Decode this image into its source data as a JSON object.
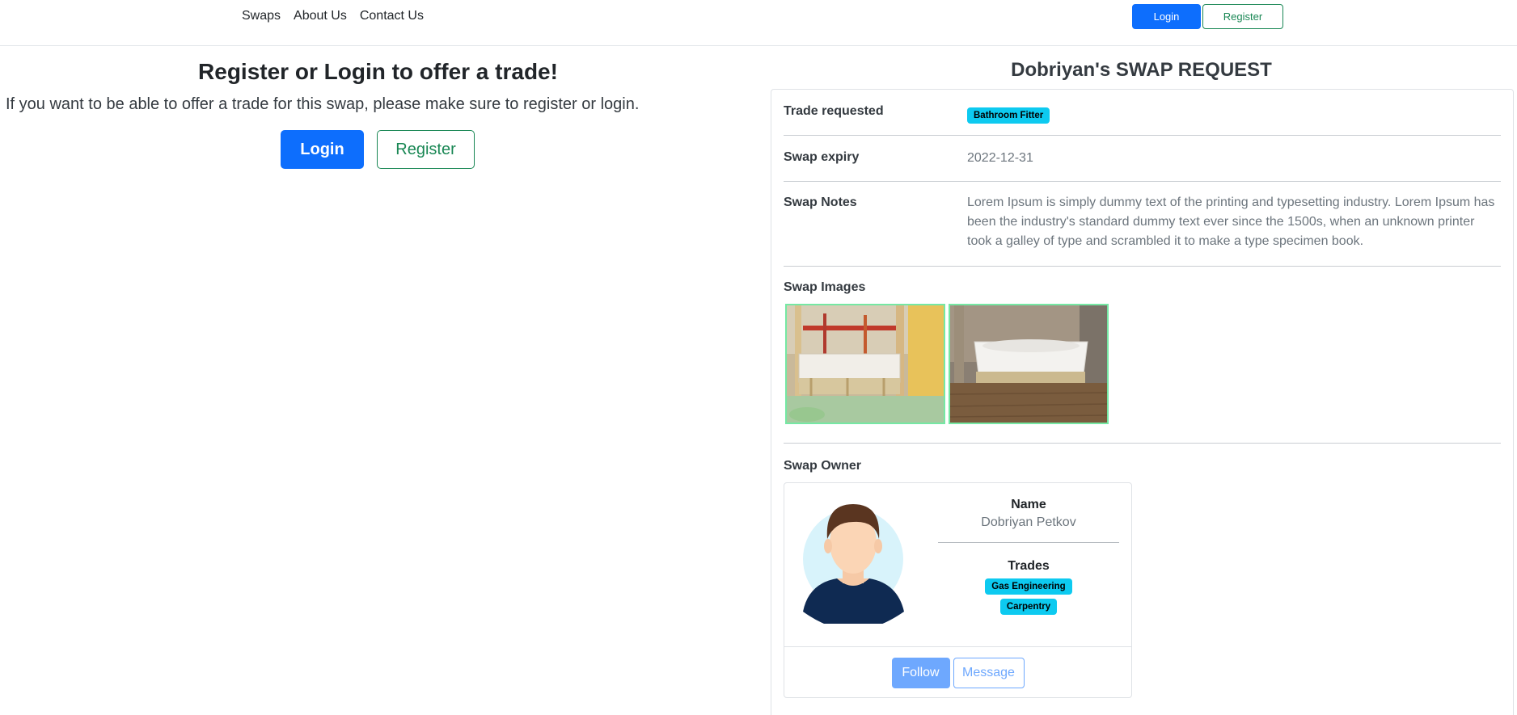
{
  "nav": {
    "links": [
      "Swaps",
      "About Us",
      "Contact Us"
    ],
    "login_label": "Login",
    "register_label": "Register"
  },
  "left": {
    "title": "Register or Login to offer a trade!",
    "text": "If you want to be able to offer a trade for this swap, please make sure to register or login.",
    "login_label": "Login",
    "register_label": "Register"
  },
  "swap": {
    "title": "Dobriyan's SWAP REQUEST",
    "trade_requested_label": "Trade requested",
    "trade_requested_badge": "Bathroom Fitter",
    "expiry_label": "Swap expiry",
    "expiry_value": "2022-12-31",
    "notes_label": "Swap Notes",
    "notes_value": "Lorem Ipsum is simply dummy text of the printing and typesetting industry. Lorem Ipsum has been the industry's standard dummy text ever since the 1500s, when an unknown printer took a galley of type and scrambled it to make a type specimen book.",
    "images_label": "Swap Images",
    "owner_label": "Swap Owner"
  },
  "owner": {
    "name_heading": "Name",
    "name": "Dobriyan Petkov",
    "trades_heading": "Trades",
    "trades": [
      "Gas Engineering",
      "Carpentry"
    ],
    "follow_label": "Follow",
    "message_label": "Message"
  },
  "colors": {
    "primary": "#0d6efd",
    "success": "#198754",
    "badge": "#0dcaf0",
    "image_border": "#75e8a4"
  }
}
